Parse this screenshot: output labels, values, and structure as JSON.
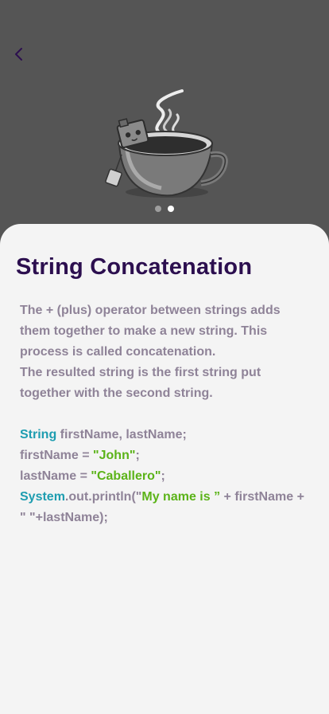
{
  "header": {
    "back_icon": "chevron-left-icon"
  },
  "illustration": {
    "name": "coffee-cup-robot"
  },
  "pager": {
    "pages": 2,
    "current": 2
  },
  "lesson": {
    "title": "String Concatenation",
    "para1": "The + (plus) operator between strings adds them together to make a new string. This process is called concatenation.",
    "para2": "The resulted string is the first string put together with the second string."
  },
  "code": {
    "line1": {
      "type": "String",
      "rest": " firstName, lastName;"
    },
    "line2": {
      "pre": "firstName = ",
      "str": "\"John\"",
      "post": ";"
    },
    "line3": {
      "pre": "lastName = ",
      "str": "\"Caballero\"",
      "post": ";"
    },
    "line4": {
      "cls": "System",
      "mid": ".out.println(\"",
      "str": "My name is ”",
      "post": " + firstName + \" \"+lastName);"
    }
  },
  "colors": {
    "title": "#2c0f4f",
    "body": "#8f8398",
    "keyword": "#1e9db0",
    "string": "#5bb318",
    "background_top": "#555555",
    "card": "#f4f4f4"
  }
}
